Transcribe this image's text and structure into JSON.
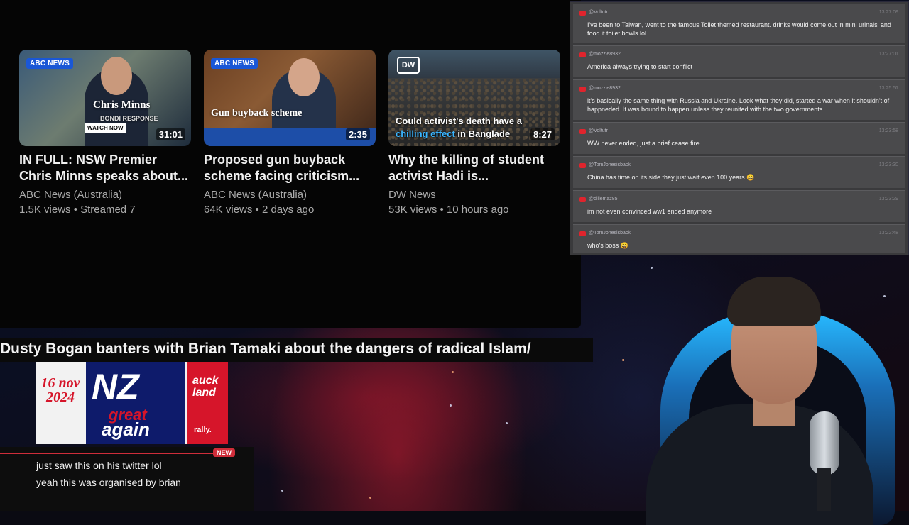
{
  "videos": [
    {
      "title": "IN FULL: NSW Premier Chris Minns speaks about...",
      "channel": "ABC News (Australia)",
      "meta": "1.5K views • Streamed 7",
      "duration": "31:01",
      "badge": "ABC NEWS",
      "caption": "Chris Minns",
      "caption_sub": "BONDI RESPONSE",
      "caption_button": "WATCH NOW"
    },
    {
      "title": "Proposed gun buyback scheme facing criticism...",
      "channel": "ABC News (Australia)",
      "meta": "64K views • 2 days ago",
      "duration": "2:35",
      "badge": "ABC NEWS",
      "caption": "Gun buyback scheme"
    },
    {
      "title": "Why the killing of student activist Hadi is...",
      "channel": "DW News",
      "meta": "53K views • 10 hours ago",
      "duration": "8:27",
      "badge": "DW",
      "caption_line1": "Could activist's death have a",
      "caption_highlight": "chilling effect",
      "caption_line2_rest": " in Banglade"
    }
  ],
  "banner": {
    "title": "Dusty Bogan banters with Brian Tamaki about the dangers of radical Islam/"
  },
  "poster": {
    "date": "16 nov 2024",
    "line1": "NZ",
    "line2": "great",
    "line3": "again",
    "city": "auck land",
    "event": "rally."
  },
  "overlay_chat": {
    "new_label": "NEW",
    "lines": [
      "just saw this on his twitter lol",
      "yeah this was organised by brian"
    ]
  },
  "live_chat": {
    "messages": [
      {
        "user": "@Voltutr",
        "time": "13:27:09",
        "text": "I've been to Taiwan, went to the famous Toilet themed restaurant. drinks would come out in mini urinals' and food it toilet bowls lol"
      },
      {
        "user": "@mozzie8932",
        "time": "13:27:01",
        "text": "America always trying to start conflict"
      },
      {
        "user": "@mozzie8932",
        "time": "13:25:51",
        "text": "it's basically the same thing with Russia and Ukraine. Look what they did, started a war when it shouldn't of happneded. It was bound to happen unless they reunited with the two governments"
      },
      {
        "user": "@Voltutr",
        "time": "13:23:58",
        "text": "WW never ended, just a brief cease fire"
      },
      {
        "user": "@TomJonesisback",
        "time": "13:23:30",
        "text": "China has time on its side they just wait even 100 years 😄"
      },
      {
        "user": "@dillemaz85",
        "time": "13:23:29",
        "text": "im not even convinced ww1 ended anymore"
      },
      {
        "user": "@TomJonesisback",
        "time": "13:22:48",
        "text": "who's boss 😄"
      }
    ]
  },
  "colors": {
    "youtube_red": "#e0242d",
    "abc_blue": "#1a57d6",
    "chat_bg": "#3a3a3c",
    "new_badge": "#cf2d3a"
  }
}
